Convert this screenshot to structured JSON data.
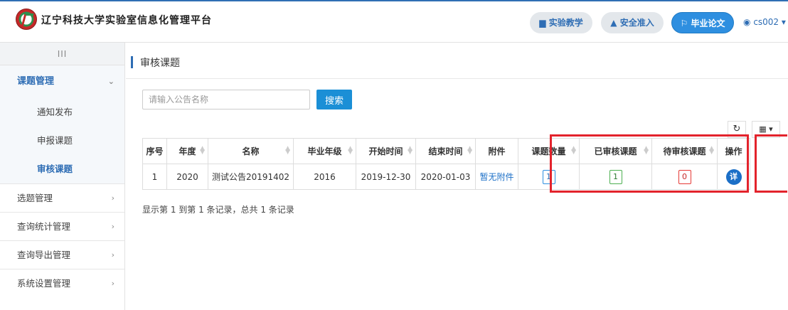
{
  "header": {
    "site_title": "辽宁科技大学实验室信息化管理平台",
    "buttons": [
      {
        "icon": "book-icon",
        "glyph": "▆",
        "label": "实验教学"
      },
      {
        "icon": "lock-icon",
        "glyph": "🔒",
        "label": "安全准入"
      },
      {
        "icon": "flag-icon",
        "glyph": "⚐",
        "label": "毕业论文"
      }
    ],
    "user": {
      "icon": "user-icon",
      "glyph": "◉",
      "name": "cs002",
      "caret": "▾"
    }
  },
  "sidebar": {
    "toggle": "III",
    "group": {
      "label": "课题管理",
      "chevron": "⌄"
    },
    "subitems": [
      {
        "label": "通知发布",
        "active": false
      },
      {
        "label": "申报课题",
        "active": false
      },
      {
        "label": "审核课题",
        "active": true
      }
    ],
    "items": [
      {
        "label": "选题管理",
        "chevron": "›"
      },
      {
        "label": "查询统计管理",
        "chevron": "›"
      },
      {
        "label": "查询导出管理",
        "chevron": "›"
      },
      {
        "label": "系统设置管理",
        "chevron": "›"
      }
    ]
  },
  "main": {
    "title": "审核课题",
    "search": {
      "placeholder": "请输入公告名称",
      "button": "搜索"
    },
    "toolbar": {
      "refresh_glyph": "↻",
      "columns_glyph": "▦ ▾"
    },
    "table": {
      "columns": [
        {
          "label": "序号",
          "width": 34,
          "sort": false
        },
        {
          "label": "年度",
          "width": 58,
          "sort": true
        },
        {
          "label": "名称",
          "width": 120,
          "sort": true
        },
        {
          "label": "毕业年级",
          "width": 88,
          "sort": true
        },
        {
          "label": "开始时间",
          "width": 84,
          "sort": true
        },
        {
          "label": "结束时间",
          "width": 84,
          "sort": true
        },
        {
          "label": "附件",
          "width": 60,
          "sort": false
        },
        {
          "label": "课题数量",
          "width": 86,
          "sort": true
        },
        {
          "label": "已审核课题",
          "width": 102,
          "sort": true
        },
        {
          "label": "待审核课题",
          "width": 92,
          "sort": true
        },
        {
          "label": "操作",
          "width": 46,
          "sort": false
        }
      ],
      "rows": [
        {
          "index": "1",
          "year": "2020",
          "name": "测试公告20191402",
          "grade": "2016",
          "start": "2019-12-30",
          "end": "2020-01-03",
          "attachment": "暂无附件",
          "topic_count": "1",
          "reviewed": "1",
          "pending": "0",
          "action": "详"
        }
      ]
    },
    "footer": "显示第 1 到第 1 条记录，总共 1 条记录"
  },
  "colors": {
    "accent": "#2e6db4",
    "primary_button": "#1b8fd6",
    "highlight": "#e3232c"
  }
}
